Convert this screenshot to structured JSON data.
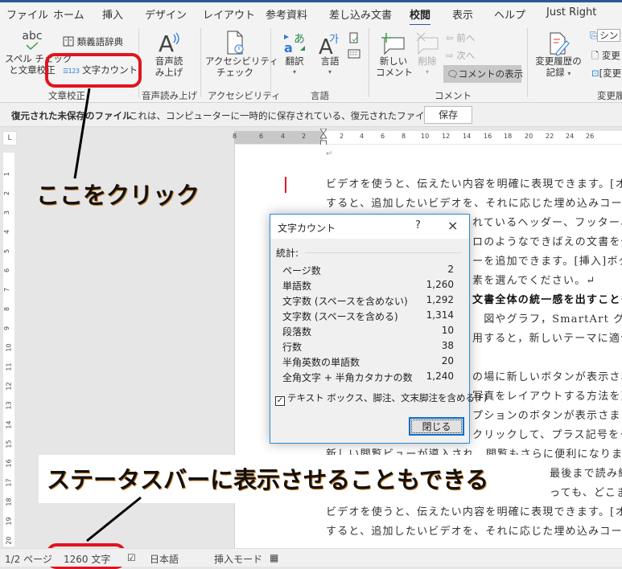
{
  "menu": {
    "tabs": [
      "ファイル",
      "ホーム",
      "挿入",
      "デザイン",
      "レイアウト",
      "参考資料",
      "差し込み文書",
      "校閲",
      "表示",
      "ヘルプ",
      "Just Right"
    ],
    "active_tab": "校閲"
  },
  "ribbon": {
    "proofing": {
      "spell_icon_text": "abc",
      "spell_label_1": "スペル チェック",
      "spell_label_2": "と文章校正",
      "thesaurus": "類義語辞典",
      "word_count": "文字カウント",
      "word_count_icon_text": "123",
      "group": "文章校正"
    },
    "speech": {
      "read_aloud_1": "音声読",
      "read_aloud_2": "み上げ",
      "group": "音声読み上げ"
    },
    "accessibility": {
      "check_1": "アクセシビリティ",
      "check_2": "チェック",
      "group": "アクセシビリティ"
    },
    "language": {
      "translate": "翻訳",
      "language": "言語",
      "group": "言語"
    },
    "comments": {
      "new_1": "新しい",
      "new_2": "コメント",
      "delete": "削除",
      "prev": "前へ",
      "next": "次へ",
      "show": "コメントの表示",
      "group": "コメント"
    },
    "tracking": {
      "track_1": "変更履歴の",
      "track_2": "記録",
      "simple": "シン",
      "changes": "変更",
      "changes2": "[変更",
      "group": "変更履"
    }
  },
  "notice": {
    "title": "復元された未保存のファイル",
    "message": "これは、コンピューターに一時的に保存されている、復元されたファイルです。",
    "save": "保存"
  },
  "ruler": {
    "corner": "L",
    "h_left": [
      "8",
      "6",
      "4",
      "2"
    ],
    "h_right": [
      "2",
      "4",
      "6",
      "8",
      "10",
      "12",
      "14",
      "16",
      "18",
      "20",
      "22",
      "24",
      "26"
    ],
    "v": [
      "1",
      "2",
      "3",
      "4",
      "5",
      "6",
      "7",
      "8",
      "9",
      "10",
      "11",
      "12",
      "13",
      "14",
      "15",
      "16",
      "17",
      "18",
      "19",
      "20"
    ]
  },
  "document": {
    "lines": [
      "ビデオを使うと、伝えたい内容を明確に表現できます。[オ",
      "すると、追加したいビデオを、それに応じた埋め込みコード",
      "れているヘッダー、フッター、",
      "ロのようなできばえの文書を作",
      "ーを追加できます。[挿入]ボタ",
      "素を選んでください。↵",
      "文書全体の統一感を出すことも",
      "　図やグラフ，SmartArt グラ",
      "用すると，新しいテーマに適合",
      "",
      "の場に新しいボタンが表示され",
      "写真をレイアウトする方法を変",
      "プションのボタンが表示さます",
      "クリックして、プラス記号をク",
      "新しい閲覧ビューが導入され、閲覧もさらに便利になりまし",
      "最後まで読み終",
      "っても、どこま",
      "ビデオを使うと、伝えたい内容を明確に表現できます。[オ",
      "すると、追加したいビデオを、それに応じた埋め込みコード"
    ]
  },
  "dialog": {
    "title": "文字カウント",
    "help": "?",
    "close_icon": "×",
    "stats_label": "統計:",
    "rows": [
      {
        "label": "ページ数",
        "value": "2"
      },
      {
        "label": "単語数",
        "value": "1,260"
      },
      {
        "label": "文字数 (スペースを含めない)",
        "value": "1,292"
      },
      {
        "label": "文字数 (スペースを含める)",
        "value": "1,314"
      },
      {
        "label": "段落数",
        "value": "10"
      },
      {
        "label": "行数",
        "value": "38"
      },
      {
        "label": "半角英数の単語数",
        "value": "20"
      },
      {
        "label": "全角文字 + 半角カタカナの数",
        "value": "1,240"
      }
    ],
    "include_checkbox": "テキスト ボックス、脚注、文末脚注を含める(F)",
    "include_checked": true,
    "close_button": "閉じる"
  },
  "annotations": {
    "click_here": "ここをクリック",
    "statusbar_note": "ステータスバーに表示させることもできる"
  },
  "statusbar": {
    "page": "1/2 ページ",
    "words": "1260 文字",
    "language": "日本語",
    "mode": "挿入モード"
  },
  "colors": {
    "accent": "#2b579a",
    "highlight": "#e0141e",
    "dialog_border": "#2b8ad8"
  }
}
